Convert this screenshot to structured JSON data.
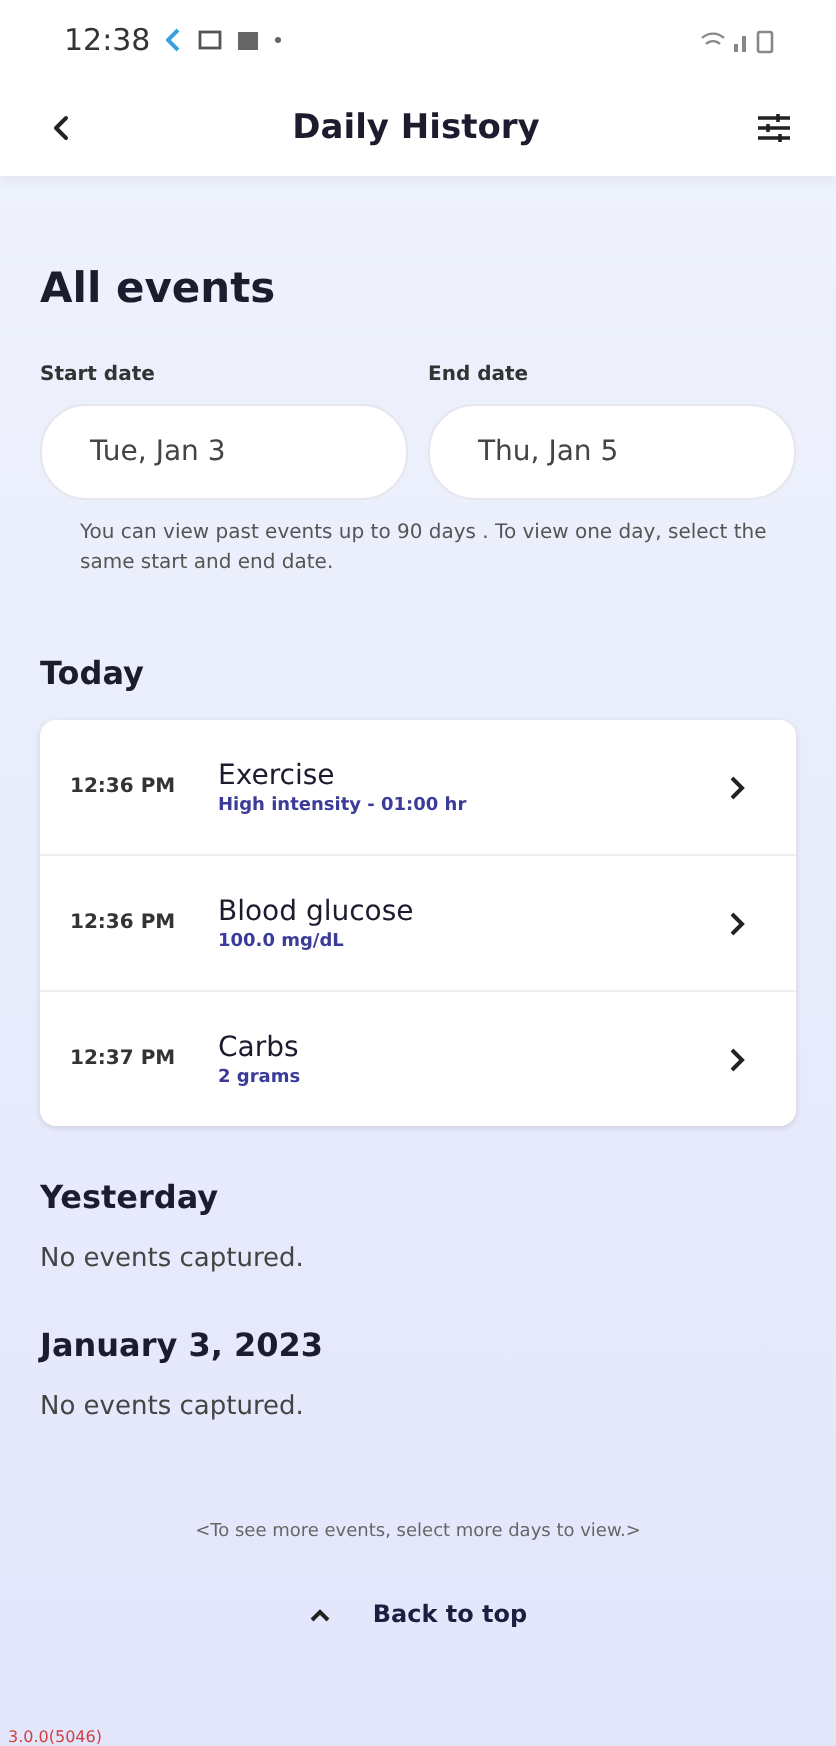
{
  "status_bar": {
    "time": "12:38"
  },
  "header": {
    "title": "Daily History"
  },
  "heading": "All events",
  "date_range": {
    "start": {
      "label": "Start date",
      "value": "Tue, Jan 3"
    },
    "end": {
      "label": "End date",
      "value": "Thu, Jan 5"
    },
    "note": "You can view past events up to 90 days . To view one day, select the same start and end date."
  },
  "days": [
    {
      "title": "Today",
      "events": [
        {
          "time": "12:36 PM",
          "name": "Exercise",
          "detail": "High intensity - 01:00 hr"
        },
        {
          "time": "12:36 PM",
          "name": "Blood glucose",
          "detail": "100.0 mg/dL"
        },
        {
          "time": "12:37 PM",
          "name": "Carbs",
          "detail": "2 grams"
        }
      ]
    },
    {
      "title": "Yesterday",
      "empty_text": "No events captured."
    },
    {
      "title": "January 3, 2023",
      "empty_text": "No events captured."
    }
  ],
  "more_hint": "<To see more events, select more days to view.>",
  "back_to_top": "Back to top",
  "version": "3.0.0(5046)"
}
